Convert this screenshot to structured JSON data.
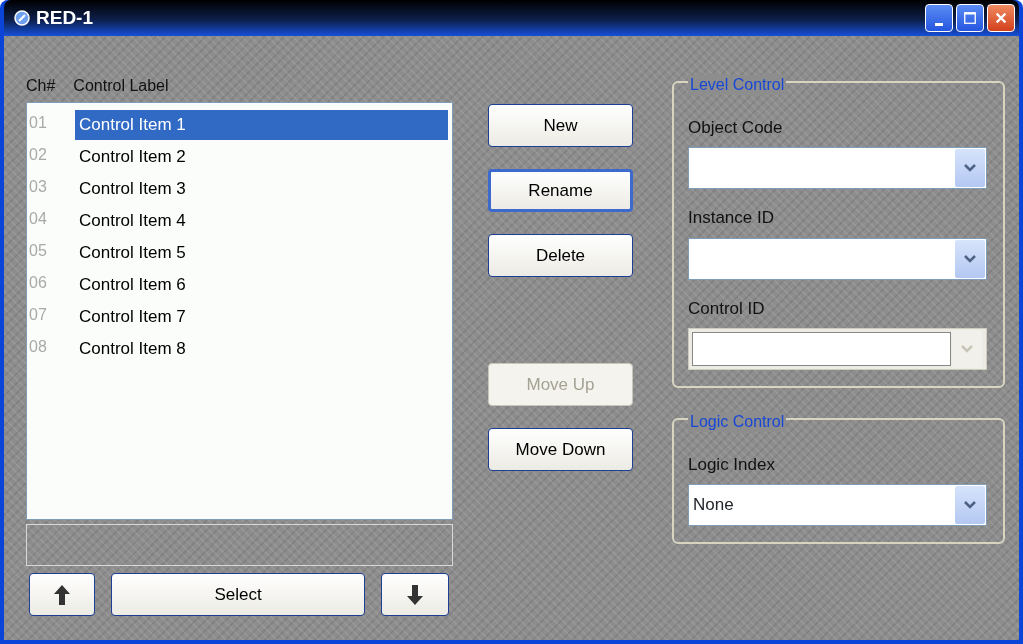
{
  "window": {
    "title": "RED-1"
  },
  "list": {
    "columns": [
      "Ch#",
      "Control Label"
    ],
    "items": [
      {
        "number": "01",
        "label": "Control Item 1",
        "selected": true
      },
      {
        "number": "02",
        "label": "Control Item 2",
        "selected": false
      },
      {
        "number": "03",
        "label": "Control Item 3",
        "selected": false
      },
      {
        "number": "04",
        "label": "Control Item 4",
        "selected": false
      },
      {
        "number": "05",
        "label": "Control Item 5",
        "selected": false
      },
      {
        "number": "06",
        "label": "Control Item 6",
        "selected": false
      },
      {
        "number": "07",
        "label": "Control Item 7",
        "selected": false
      },
      {
        "number": "08",
        "label": "Control Item 8",
        "selected": false
      }
    ],
    "select_button": "Select"
  },
  "buttons": [
    {
      "label": "New",
      "disabled": false,
      "focused": false
    },
    {
      "label": "Rename",
      "disabled": false,
      "focused": true
    },
    {
      "label": "Delete",
      "disabled": false,
      "focused": false
    },
    {
      "label": "Move Up",
      "disabled": true,
      "focused": false
    },
    {
      "label": "Move Down",
      "disabled": false,
      "focused": false
    }
  ],
  "groups": [
    {
      "title": "Level Control",
      "fields": [
        {
          "label": "Object Code",
          "disabled": false
        },
        {
          "label": "Instance ID",
          "disabled": false
        },
        {
          "label": "Control ID",
          "disabled": true
        }
      ]
    },
    {
      "title": "Logic Control",
      "fields": [
        {
          "label": "Logic Index",
          "value": "None",
          "disabled": false
        }
      ]
    }
  ]
}
